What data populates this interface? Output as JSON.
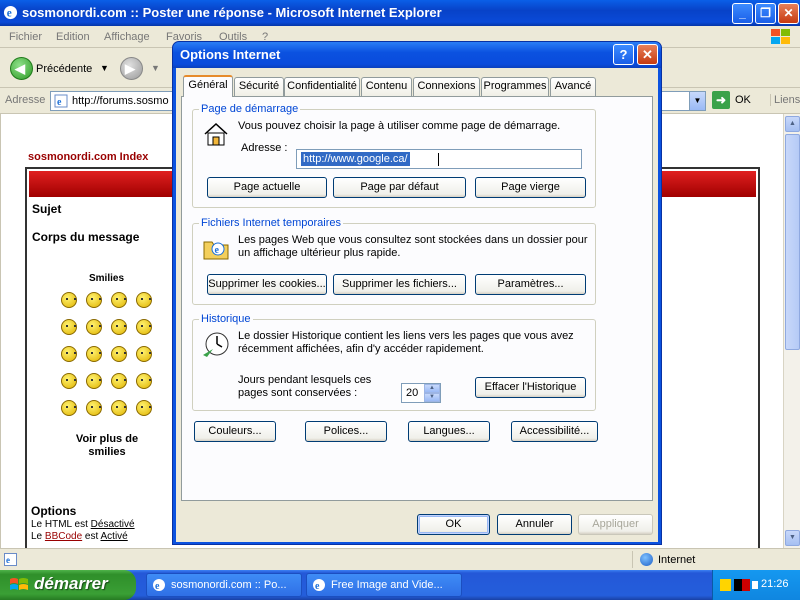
{
  "ie": {
    "title": "sosmonordi.com :: Poster une réponse - Microsoft Internet Explorer",
    "menu": [
      "Fichier",
      "Edition",
      "Affichage",
      "Favoris",
      "Outils",
      "?"
    ],
    "back_label": "Précédente",
    "address_label": "Adresse",
    "address_value": "http://forums.sosmo",
    "go_label": "OK",
    "links_label": "Liens",
    "status_zone": "Internet"
  },
  "page": {
    "forum_index": "sosmonordi.com Index",
    "sujet": "Sujet",
    "corps": "Corps du message",
    "smilies_title": "Smilies",
    "more_smilies": "Voir plus de smilies",
    "options_title": "Options",
    "opt_html_prefix": "Le HTML est ",
    "opt_html_value": "Désactivé",
    "opt_bb_prefix": "Le ",
    "opt_bb_link": "BBCode",
    "opt_bb_mid": " est ",
    "opt_bb_value": "Activé"
  },
  "taskbar": {
    "start": "démarrer",
    "tasks": [
      "sosmonordi.com :: Po...",
      "Free Image and Vide..."
    ],
    "clock": "21:26"
  },
  "dialog": {
    "title": "Options Internet",
    "help": "?",
    "close": "✕",
    "tabs": [
      "Général",
      "Sécurité",
      "Confidentialité",
      "Contenu",
      "Connexions",
      "Programmes",
      "Avancé"
    ],
    "home": {
      "legend": "Page de démarrage",
      "desc": "Vous pouvez choisir la page à utiliser comme page de démarrage.",
      "address_label": "Adresse :",
      "address_value": "http://www.google.ca/",
      "buttons": [
        "Page actuelle",
        "Page par défaut",
        "Page vierge"
      ]
    },
    "temp": {
      "legend": "Fichiers Internet temporaires",
      "desc": "Les pages Web que vous consultez sont stockées dans un dossier pour un affichage ultérieur plus rapide.",
      "buttons": [
        "Supprimer les cookies...",
        "Supprimer les fichiers...",
        "Paramètres..."
      ]
    },
    "history": {
      "legend": "Historique",
      "desc": "Le dossier Historique contient les liens vers les pages que vous avez récemment affichées, afin d'y accéder rapidement.",
      "days_label": "Jours pendant lesquels ces pages sont conservées :",
      "days_value": "20",
      "clear_button": "Effacer l'Historique"
    },
    "bottom_buttons": [
      "Couleurs...",
      "Polices...",
      "Langues...",
      "Accessibilité..."
    ],
    "footer": {
      "ok": "OK",
      "cancel": "Annuler",
      "apply": "Appliquer"
    }
  }
}
